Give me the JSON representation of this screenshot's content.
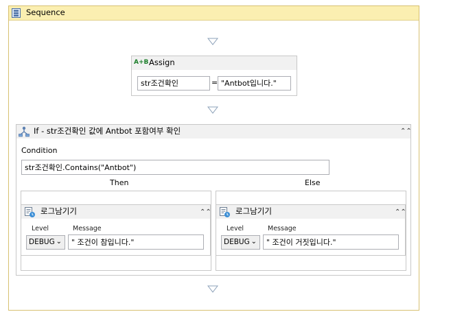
{
  "sequence": {
    "title": "Sequence"
  },
  "assign": {
    "title": "Assign",
    "icon_text": "A+B",
    "to_value": "str조건확인",
    "equals": "=",
    "value": "\"Antbot입니다.\""
  },
  "if_activity": {
    "title": "If - str조건확인 값에 Antbot 포함여부 확인",
    "condition_label": "Condition",
    "condition_value": "str조건확인.Contains(\"Antbot\")",
    "then_label": "Then",
    "else_label": "Else"
  },
  "then_log": {
    "title": "로그남기기",
    "level_label": "Level",
    "message_label": "Message",
    "level_value": "DEBUG",
    "message_value": "\" 조건이 참입니다.\""
  },
  "else_log": {
    "title": "로그남기기",
    "level_label": "Level",
    "message_label": "Message",
    "level_value": "DEBUG",
    "message_value": "\" 조건이 거짓입니다.\""
  },
  "icons": {
    "collapse": "⌃⌃",
    "dropdown": "⌄"
  }
}
